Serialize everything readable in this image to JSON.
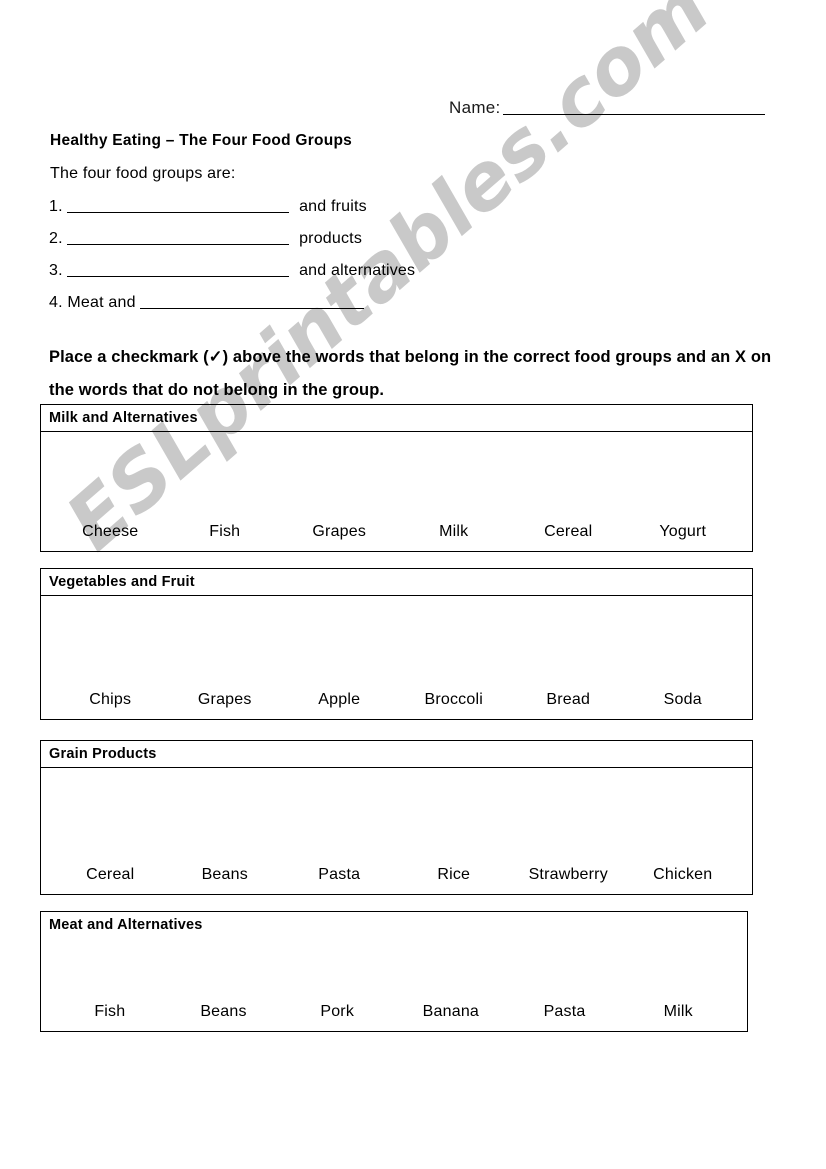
{
  "header": {
    "name_label": "Name:",
    "name_value": ""
  },
  "worksheet": {
    "title": "Healthy Eating – The Four Food Groups",
    "intro": "The four food groups are:",
    "blanks": [
      {
        "number": "1.",
        "prefix": "",
        "suffix": "and fruits"
      },
      {
        "number": "2.",
        "prefix": "",
        "suffix": "products"
      },
      {
        "number": "3.",
        "prefix": "",
        "suffix": "and alternatives"
      },
      {
        "number": "4.",
        "prefix": "Meat and",
        "suffix": ""
      }
    ],
    "instruction": "Place a checkmark (✓) above the words that belong in the correct food groups and an X on the words that do not belong in the group."
  },
  "food_groups": [
    {
      "id": "milk",
      "header": "Milk and Alternatives",
      "words": [
        "Cheese",
        "Fish",
        "Grapes",
        "Milk",
        "Cereal",
        "Yogurt"
      ]
    },
    {
      "id": "vegetables",
      "header": "Vegetables and Fruit",
      "words": [
        "Chips",
        "Grapes",
        "Apple",
        "Broccoli",
        "Bread",
        "Soda"
      ]
    },
    {
      "id": "grain",
      "header": "Grain Products",
      "words": [
        "Cereal",
        "Beans",
        "Pasta",
        "Rice",
        "Strawberry",
        "Chicken"
      ]
    },
    {
      "id": "meat",
      "header": "Meat and Alternatives",
      "words": [
        "Fish",
        "Beans",
        "Pork",
        "Banana",
        "Pasta",
        "Milk"
      ]
    }
  ],
  "watermark": {
    "text": "ESLprintables.com",
    "color": "#c9c9c9"
  }
}
